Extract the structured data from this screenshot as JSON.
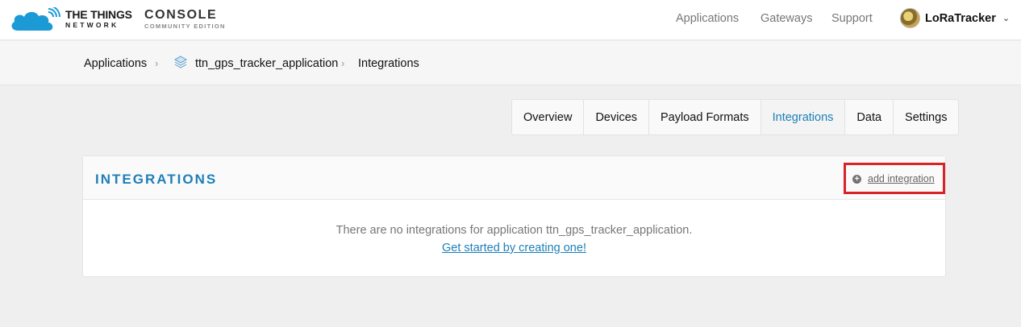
{
  "header": {
    "brand_title": "THE THINGS",
    "brand_sub": "NETWORK",
    "console_title": "CONSOLE",
    "console_sub": "COMMUNITY EDITION",
    "nav": [
      "Applications",
      "Gateways",
      "Support"
    ],
    "username": "LoRaTracker",
    "caret": "⌄"
  },
  "breadcrumb": {
    "items": [
      "Applications",
      "ttn_gps_tracker_application",
      "Integrations"
    ],
    "separator": "›"
  },
  "tabs": [
    {
      "label": "Overview",
      "active": false
    },
    {
      "label": "Devices",
      "active": false
    },
    {
      "label": "Payload Formats",
      "active": false
    },
    {
      "label": "Integrations",
      "active": true
    },
    {
      "label": "Data",
      "active": false
    },
    {
      "label": "Settings",
      "active": false
    }
  ],
  "panel": {
    "title": "INTEGRATIONS",
    "add_label": "add integration",
    "add_icon": "+",
    "empty_message": "There are no integrations for application ttn_gps_tracker_application.",
    "empty_cta": "Get started by creating one!"
  },
  "colors": {
    "accent": "#1d7fb8",
    "highlight_box": "#d8232a"
  }
}
